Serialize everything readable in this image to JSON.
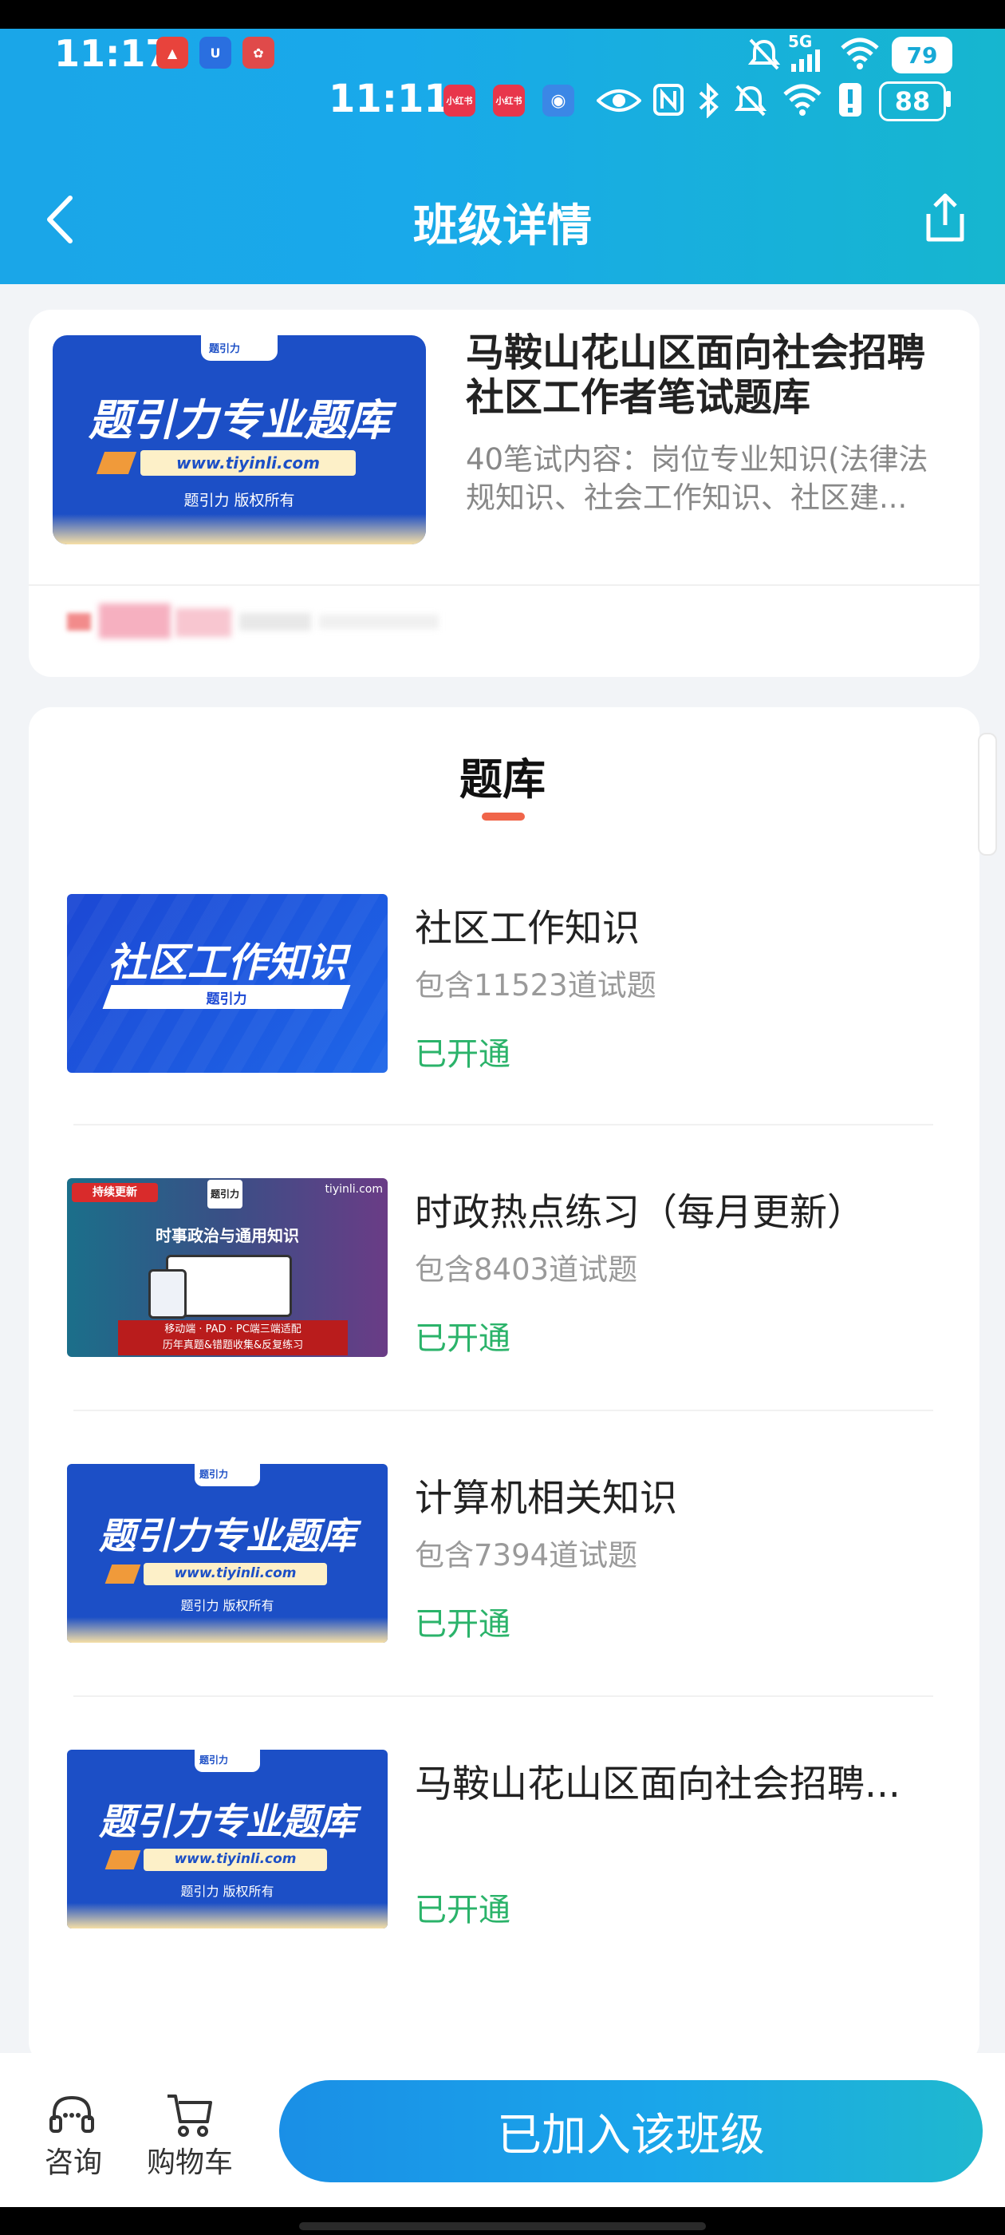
{
  "status_bar": {
    "time_primary": "11:17",
    "time_secondary": "11:11",
    "network_label": "5G",
    "battery_primary": "79",
    "battery_secondary": "88",
    "app_icons": [
      "app-red-icon",
      "app-blue-icon",
      "app-red-icon-2"
    ],
    "secondary_app_icons": [
      "xiaohongshu-icon",
      "xiaohongshu-icon-2",
      "translate-icon"
    ],
    "status_icons": [
      "mute-icon",
      "signal-icon",
      "wifi-icon",
      "eye-icon",
      "nfc-icon",
      "bluetooth-icon",
      "alert-icon"
    ]
  },
  "nav": {
    "title": "班级详情",
    "back_icon": "chevron-left-icon",
    "share_icon": "share-icon"
  },
  "course": {
    "title": "马鞍山花山区面向社会招聘社区工作者笔试题库",
    "description": "40笔试内容：岗位专业知识(法律法规知识、社会工作知识、社区建..."
  },
  "thumb_brand": {
    "logo_text": "题引力",
    "headline": "题引力专业题库",
    "url": "www.tiyinli.com",
    "copyright": "题引力 版权所有"
  },
  "section": {
    "title": "题库"
  },
  "items": [
    {
      "title": "社区工作知识",
      "count": "包含11523道试题",
      "status": "已开通",
      "thumb_type": "topic",
      "thumb_headline": "社区工作知识",
      "thumb_sub": "题引力"
    },
    {
      "title": "时政热点练习（每月更新）",
      "count": "包含8403道试题",
      "status": "已开通",
      "thumb_type": "news",
      "thumb_badge": "持续更新",
      "thumb_logo": "题引力",
      "thumb_site": "tiyinli.com",
      "thumb_headline": "时事政治与通用知识",
      "thumb_line1": "移动端 · PAD · PC端三端适配",
      "thumb_line2": "历年真题&错题收集&反复练习"
    },
    {
      "title": "计算机相关知识",
      "count": "包含7394道试题",
      "status": "已开通",
      "thumb_type": "brand"
    },
    {
      "title": "马鞍山花山区面向社会招聘...",
      "count": "",
      "status": "已开通",
      "thumb_type": "brand"
    }
  ],
  "bottom_bar": {
    "consult_label": "咨询",
    "cart_label": "购物车",
    "join_label": "已加入该班级",
    "consult_icon": "headset-icon",
    "cart_icon": "cart-icon"
  },
  "colors": {
    "header_start": "#1aa6e8",
    "header_end": "#16b6cf",
    "status_green": "#2bb36a",
    "accent_orange": "#f0654a",
    "thumb_blue": "#1b4fc8"
  }
}
